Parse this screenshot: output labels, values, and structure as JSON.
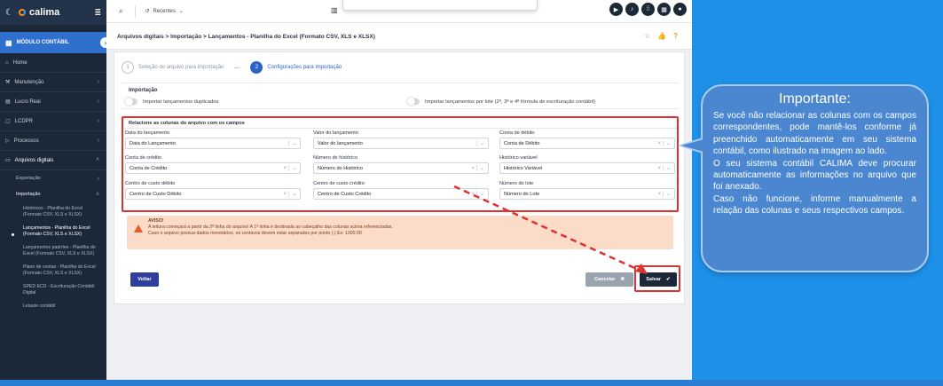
{
  "app": {
    "name": "calima"
  },
  "sidebar": {
    "module": "MÓDULO CONTÁBIL",
    "items": [
      {
        "label": "Home"
      },
      {
        "label": "Manutenção"
      },
      {
        "label": "Lucro Real"
      },
      {
        "label": "LCDPR"
      },
      {
        "label": "Processos"
      },
      {
        "label": "Arquivos digitais"
      }
    ],
    "subitems": [
      {
        "label": "Exportação"
      },
      {
        "label": "Importação"
      }
    ],
    "leaves": [
      {
        "label": "Históricos - Planilha do Excel (Formato CSV, XLS e XLSX)"
      },
      {
        "label": "Lançamentos - Planilha do Excel (Formato CSV, XLS e XLSX)"
      },
      {
        "label": "Lançamentos padrões - Planilha do Excel (Formato CSV, XLS e XLSX)"
      },
      {
        "label": "Plano de contas - Planilha do Excel (Formato CSV, XLS e XLSX)"
      },
      {
        "label": "SPED ECD - Escrituração Contábil Digital"
      },
      {
        "label": "Leiaute contábil"
      }
    ]
  },
  "topbar": {
    "recentes": "Recentes"
  },
  "page": {
    "breadcrumb": "Arquivos digitais > Importação > Lançamentos - Planilha do Excel (Formato CSV, XLS e XLSX)",
    "steps": [
      {
        "num": "1",
        "label": "Seleção do arquivo para importação"
      },
      {
        "num": "2",
        "label": "Configurações para importação"
      }
    ],
    "section": "Importação",
    "toggles": [
      {
        "label": "Importar lançamentos duplicados"
      },
      {
        "label": "Importar lançamentos por lote (2ª, 3ª e 4ª fórmula de escrituração contábil)"
      }
    ],
    "mapping_title": "Relacione as colunas do arquivo com os campos",
    "fields": [
      {
        "label": "Data do lançamento",
        "value": "Data do Lançamento"
      },
      {
        "label": "Valor do lançamento",
        "value": "Valor do lançamento"
      },
      {
        "label": "Conta de débito",
        "value": "Conta de Débito"
      },
      {
        "label": "Conta de crédito",
        "value": "Conta de Crédito"
      },
      {
        "label": "Número do histórico",
        "value": "Número do Histórico"
      },
      {
        "label": "Histórico variável",
        "value": "Histórico Variável"
      },
      {
        "label": "Centro de custo débito",
        "value": "Centro de Custo Débito"
      },
      {
        "label": "Centro de custo crédito",
        "value": "Centro de Custo Crédito"
      },
      {
        "label": "Número do lote",
        "value": "Número do Lote"
      }
    ],
    "warning": {
      "title": "AVISO!",
      "line1": "A leitura começará a partir da 2ª linha do arquivo! A 1ª linha é destinada ao cabeçalho das colunas acima referenciadas.",
      "line2": "Caso o arquivo possua dados monetários, os centavos devem estar separados por ponto (.) Ex: 1000.00"
    },
    "buttons": {
      "voltar": "Voltar",
      "cancelar": "Cancelar",
      "salvar": "Salvar"
    }
  },
  "callout": {
    "title": "Importante:",
    "p1": "Se você não relacionar as colunas com os campos correspondentes, pode mantê-los conforme já preenchido automaticamente em seu sistema contábil, como ilustrado na imagem ao lado.",
    "p2": "O seu sistema contábil CALIMA deve procurar automaticamente as informações no arquivo que foi anexado.",
    "p3": "Caso não funcione, informe manualmente a relação das colunas e seus respectivos campos."
  },
  "colors": {
    "sidebar": "#1b2838",
    "accent": "#2f6fce",
    "highlight": "#e03131",
    "callout": "#4a87d0",
    "background": "#1e90e8"
  }
}
